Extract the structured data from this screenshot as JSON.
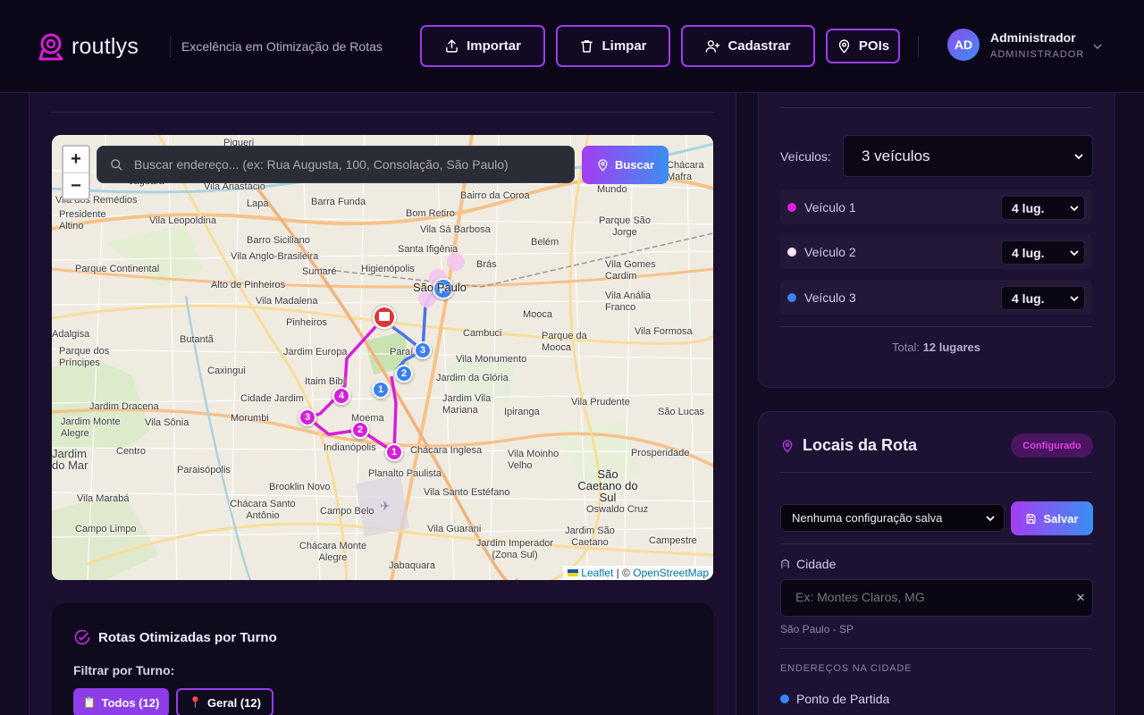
{
  "header": {
    "brand": "routlys",
    "tagline": "Excelência em Otimização de Rotas",
    "buttons": [
      {
        "label": "Importar",
        "icon": "upload-icon"
      },
      {
        "label": "Limpar",
        "icon": "trash-icon"
      },
      {
        "label": "Cadastrar",
        "icon": "user-plus-icon"
      },
      {
        "label": "POIs",
        "icon": "map-pin-icon"
      }
    ],
    "user": {
      "initials": "AD",
      "name": "Administrador",
      "role": "ADMINISTRADOR"
    }
  },
  "map": {
    "search_placeholder": "Buscar endereço... (ex: Rua Augusta, 100, Consolação, São Paulo)",
    "search_button": "Buscar",
    "zoom_in": "+",
    "zoom_out": "−",
    "attribution": {
      "leaflet": "Leaflet",
      "sep": " | © ",
      "osm": "OpenStreetMap"
    },
    "labels": [
      "Piqueri",
      "Jaguara",
      "Vila Anastácio",
      "Lapa",
      "Barra Funda",
      "Bairro da Coroa",
      "Bom Retiro",
      "Vila dos Remédios",
      "Presidente Altino",
      "Vila Leopoldina",
      "Vila Sá Barbosa",
      "Parque São Jorge",
      "Belém",
      "Barro Siciliano",
      "Santa Ifigênia",
      "Vila Anglo-Brasileira",
      "Brás",
      "Parque Continental",
      "Higienópolis",
      "Sumaré",
      "Vila Gomes Cardim",
      "Alto de Pinheiros",
      "São Paulo",
      "Vila Anália Franco",
      "Vila Madalena",
      "Mooca",
      "Pinheiros",
      "Adalgisa",
      "Butantã",
      "Cambuci",
      "Vila Formosa",
      "Parque dos Príncipes",
      "Jardim Europa",
      "Paraí",
      "Parque da Mooca",
      "Vila Monumento",
      "Caxingui",
      "Itaim Bibi",
      "Jardim da Glória",
      "Cidade Jardim",
      "Jardim Vila Mariana",
      "Jardim Dracena",
      "Vila Prudente",
      "Morumbi",
      "Moema",
      "Ipiranga",
      "São Lucas",
      "Jardim Monte Alegre",
      "Vila Sônia",
      "Indianópolis",
      "Chácara Inglesa",
      "Centro",
      "Vila Moinho Velho",
      "Prosperidade",
      "Paraisópolis",
      "Planalto Paulista",
      "São Caetano do Sul",
      "Brooklin Novo",
      "Vila Santo Estéfano",
      "Vila Marabá",
      "Chácara Santo Antônio",
      "Campo Belo",
      "Oswaldo Cruz",
      "Campo Limpo",
      "Vila Guarani",
      "Jardim Imperador (Zona Sul)",
      "Campestre",
      "Chácara Monte Alegre",
      "Jardim São Caetano",
      "Jabaquara",
      "Mundo",
      "Chácara Mafra",
      "Jardim do Mar"
    ],
    "pins": [
      {
        "label": "1",
        "color": "#d61fd9"
      },
      {
        "label": "2",
        "color": "#d61fd9"
      },
      {
        "label": "3",
        "color": "#d61fd9"
      },
      {
        "label": "4",
        "color": "#d61fd9"
      },
      {
        "label": "1",
        "color": "#3b7ff0"
      },
      {
        "label": "2",
        "color": "#3b7ff0"
      },
      {
        "label": "3",
        "color": "#3b7ff0"
      },
      {
        "label": "P",
        "color": "#3b7ff0"
      }
    ]
  },
  "routes": {
    "title": "Rotas Otimizadas por Turno",
    "filter_label": "Filtrar por Turno:",
    "chips": [
      {
        "label": "Todos (12)",
        "icon": "📋"
      },
      {
        "label": "Geral (12)",
        "icon": "📍"
      }
    ]
  },
  "vehicles": {
    "label": "Veículos:",
    "selected": "3 veículos",
    "rows": [
      {
        "name": "Veículo 1",
        "seats": "4 lug.",
        "color": "#e11ee6"
      },
      {
        "name": "Veículo 2",
        "seats": "4 lug.",
        "color": "#fbe4f6"
      },
      {
        "name": "Veículo 3",
        "seats": "4 lug.",
        "color": "#3b82f6"
      }
    ],
    "total_prefix": "Total: ",
    "total_value": "12 lugares"
  },
  "locations": {
    "title": "Locais da Rota",
    "badge": "Configurado",
    "config_select": "Nenhuma configuração salva",
    "save_button": "Salvar",
    "city_label": "Cidade",
    "city_placeholder": "Ex: Montes Claros, MG",
    "city_clear": "×",
    "city_current": "São Paulo - SP",
    "section_label": "ENDEREÇOS NA CIDADE",
    "start_point": "Ponto de Partida"
  },
  "colors": {
    "accent": "#9b3df0",
    "brand_gradient_start": "#a53df2",
    "brand_gradient_end": "#3b8ff3"
  }
}
